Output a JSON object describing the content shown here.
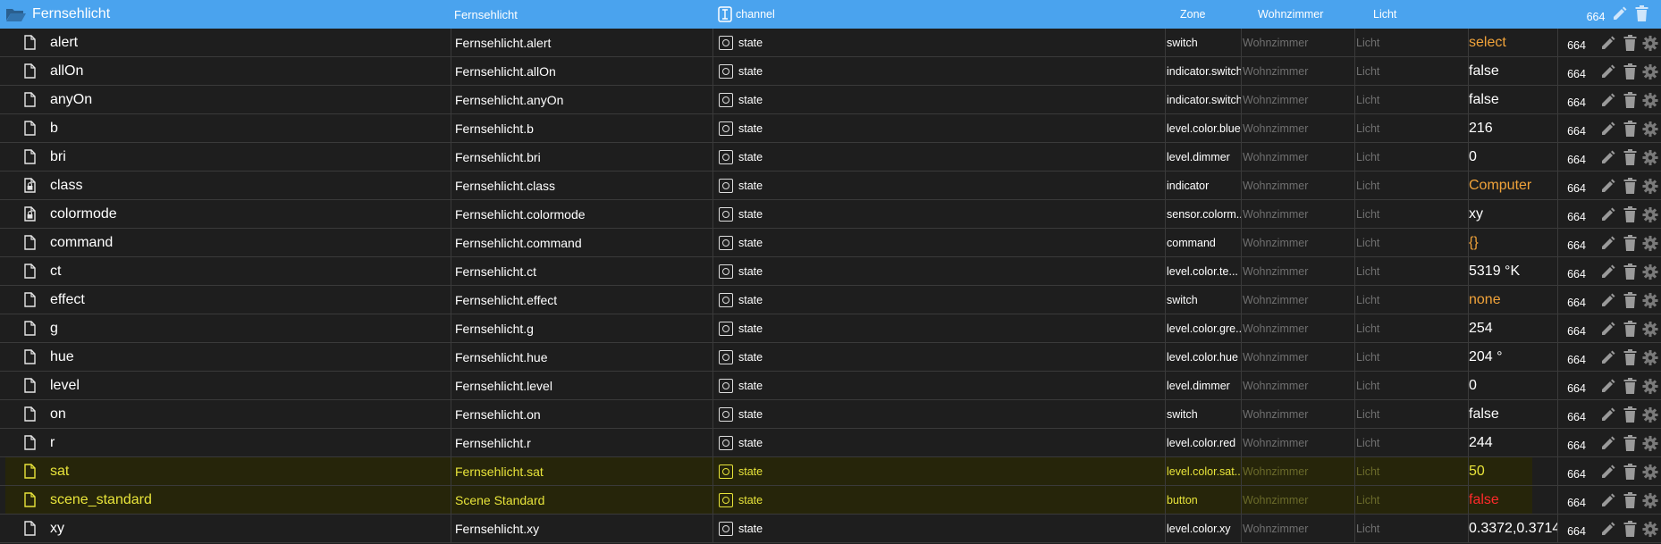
{
  "header": {
    "name": "Fernsehlicht",
    "id": "Fernsehlicht",
    "type": "channel",
    "role": "Zone",
    "room": "Wohnzimmer",
    "function": "Licht",
    "acl": "664"
  },
  "rows": [
    {
      "name": "alert",
      "id": "Fernsehlicht.alert",
      "type": "state",
      "role": "switch",
      "room": "Wohnzimmer",
      "function": "Licht",
      "value": "select",
      "acl": "664"
    },
    {
      "name": "allOn",
      "id": "Fernsehlicht.allOn",
      "type": "state",
      "role": "indicator.switch",
      "room": "Wohnzimmer",
      "function": "Licht",
      "value": "false",
      "acl": "664"
    },
    {
      "name": "anyOn",
      "id": "Fernsehlicht.anyOn",
      "type": "state",
      "role": "indicator.switch",
      "room": "Wohnzimmer",
      "function": "Licht",
      "value": "false",
      "acl": "664"
    },
    {
      "name": "b",
      "id": "Fernsehlicht.b",
      "type": "state",
      "role": "level.color.blue",
      "room": "Wohnzimmer",
      "function": "Licht",
      "value": "216",
      "acl": "664"
    },
    {
      "name": "bri",
      "id": "Fernsehlicht.bri",
      "type": "state",
      "role": "level.dimmer",
      "room": "Wohnzimmer",
      "function": "Licht",
      "value": "0",
      "acl": "664"
    },
    {
      "name": "class",
      "id": "Fernsehlicht.class",
      "type": "state",
      "role": "indicator",
      "room": "Wohnzimmer",
      "function": "Licht",
      "value": "Computer",
      "acl": "664"
    },
    {
      "name": "colormode",
      "id": "Fernsehlicht.colormode",
      "type": "state",
      "role": "sensor.colorm...",
      "room": "Wohnzimmer",
      "function": "Licht",
      "value": "xy",
      "acl": "664"
    },
    {
      "name": "command",
      "id": "Fernsehlicht.command",
      "type": "state",
      "role": "command",
      "room": "Wohnzimmer",
      "function": "Licht",
      "value": "{}",
      "acl": "664"
    },
    {
      "name": "ct",
      "id": "Fernsehlicht.ct",
      "type": "state",
      "role": "level.color.te...",
      "room": "Wohnzimmer",
      "function": "Licht",
      "value": "5319 °K",
      "acl": "664"
    },
    {
      "name": "effect",
      "id": "Fernsehlicht.effect",
      "type": "state",
      "role": "switch",
      "room": "Wohnzimmer",
      "function": "Licht",
      "value": "none",
      "acl": "664"
    },
    {
      "name": "g",
      "id": "Fernsehlicht.g",
      "type": "state",
      "role": "level.color.gre...",
      "room": "Wohnzimmer",
      "function": "Licht",
      "value": "254",
      "acl": "664"
    },
    {
      "name": "hue",
      "id": "Fernsehlicht.hue",
      "type": "state",
      "role": "level.color.hue",
      "room": "Wohnzimmer",
      "function": "Licht",
      "value": "204 °",
      "acl": "664"
    },
    {
      "name": "level",
      "id": "Fernsehlicht.level",
      "type": "state",
      "role": "level.dimmer",
      "room": "Wohnzimmer",
      "function": "Licht",
      "value": "0",
      "acl": "664"
    },
    {
      "name": "on",
      "id": "Fernsehlicht.on",
      "type": "state",
      "role": "switch",
      "room": "Wohnzimmer",
      "function": "Licht",
      "value": "false",
      "acl": "664"
    },
    {
      "name": "r",
      "id": "Fernsehlicht.r",
      "type": "state",
      "role": "level.color.red",
      "room": "Wohnzimmer",
      "function": "Licht",
      "value": "244",
      "acl": "664"
    },
    {
      "name": "sat",
      "id": "Fernsehlicht.sat",
      "type": "state",
      "role": "level.color.sat...",
      "room": "Wohnzimmer",
      "function": "Licht",
      "value": "50",
      "acl": "664"
    },
    {
      "name": "scene_standard",
      "id": "Scene Standard",
      "type": "state",
      "role": "button",
      "room": "Wohnzimmer",
      "function": "Licht",
      "value": "false",
      "acl": "664"
    },
    {
      "name": "xy",
      "id": "Fernsehlicht.xy",
      "type": "state",
      "role": "level.color.xy",
      "room": "Wohnzimmer",
      "function": "Licht",
      "value": "0.3372,0.3714",
      "acl": "664"
    }
  ],
  "colors": {
    "header_bg": "#4aa3ee",
    "row_bg": "#1e1e1e",
    "highlight_bg": "#26250a",
    "highlight_text": "#e8e43a",
    "value_string": "#f1a33a",
    "value_false_highlight": "#ff2a2a",
    "muted_text": "#707070"
  }
}
